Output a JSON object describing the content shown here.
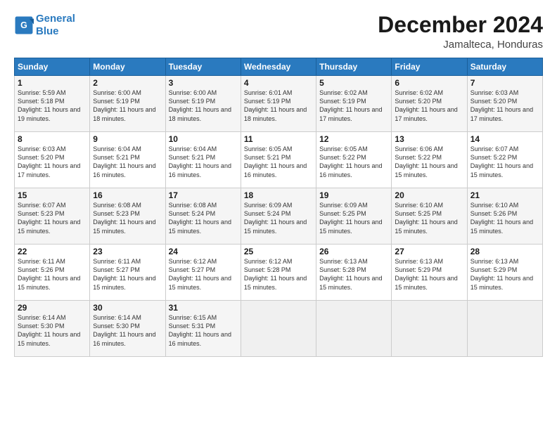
{
  "logo": {
    "line1": "General",
    "line2": "Blue"
  },
  "title": "December 2024",
  "subtitle": "Jamalteca, Honduras",
  "days_of_week": [
    "Sunday",
    "Monday",
    "Tuesday",
    "Wednesday",
    "Thursday",
    "Friday",
    "Saturday"
  ],
  "weeks": [
    [
      {
        "day": "1",
        "sunrise": "5:59 AM",
        "sunset": "5:18 PM",
        "daylight": "11 hours and 19 minutes."
      },
      {
        "day": "2",
        "sunrise": "6:00 AM",
        "sunset": "5:19 PM",
        "daylight": "11 hours and 18 minutes."
      },
      {
        "day": "3",
        "sunrise": "6:00 AM",
        "sunset": "5:19 PM",
        "daylight": "11 hours and 18 minutes."
      },
      {
        "day": "4",
        "sunrise": "6:01 AM",
        "sunset": "5:19 PM",
        "daylight": "11 hours and 18 minutes."
      },
      {
        "day": "5",
        "sunrise": "6:02 AM",
        "sunset": "5:19 PM",
        "daylight": "11 hours and 17 minutes."
      },
      {
        "day": "6",
        "sunrise": "6:02 AM",
        "sunset": "5:20 PM",
        "daylight": "11 hours and 17 minutes."
      },
      {
        "day": "7",
        "sunrise": "6:03 AM",
        "sunset": "5:20 PM",
        "daylight": "11 hours and 17 minutes."
      }
    ],
    [
      {
        "day": "8",
        "sunrise": "6:03 AM",
        "sunset": "5:20 PM",
        "daylight": "11 hours and 17 minutes."
      },
      {
        "day": "9",
        "sunrise": "6:04 AM",
        "sunset": "5:21 PM",
        "daylight": "11 hours and 16 minutes."
      },
      {
        "day": "10",
        "sunrise": "6:04 AM",
        "sunset": "5:21 PM",
        "daylight": "11 hours and 16 minutes."
      },
      {
        "day": "11",
        "sunrise": "6:05 AM",
        "sunset": "5:21 PM",
        "daylight": "11 hours and 16 minutes."
      },
      {
        "day": "12",
        "sunrise": "6:05 AM",
        "sunset": "5:22 PM",
        "daylight": "11 hours and 16 minutes."
      },
      {
        "day": "13",
        "sunrise": "6:06 AM",
        "sunset": "5:22 PM",
        "daylight": "11 hours and 15 minutes."
      },
      {
        "day": "14",
        "sunrise": "6:07 AM",
        "sunset": "5:22 PM",
        "daylight": "11 hours and 15 minutes."
      }
    ],
    [
      {
        "day": "15",
        "sunrise": "6:07 AM",
        "sunset": "5:23 PM",
        "daylight": "11 hours and 15 minutes."
      },
      {
        "day": "16",
        "sunrise": "6:08 AM",
        "sunset": "5:23 PM",
        "daylight": "11 hours and 15 minutes."
      },
      {
        "day": "17",
        "sunrise": "6:08 AM",
        "sunset": "5:24 PM",
        "daylight": "11 hours and 15 minutes."
      },
      {
        "day": "18",
        "sunrise": "6:09 AM",
        "sunset": "5:24 PM",
        "daylight": "11 hours and 15 minutes."
      },
      {
        "day": "19",
        "sunrise": "6:09 AM",
        "sunset": "5:25 PM",
        "daylight": "11 hours and 15 minutes."
      },
      {
        "day": "20",
        "sunrise": "6:10 AM",
        "sunset": "5:25 PM",
        "daylight": "11 hours and 15 minutes."
      },
      {
        "day": "21",
        "sunrise": "6:10 AM",
        "sunset": "5:26 PM",
        "daylight": "11 hours and 15 minutes."
      }
    ],
    [
      {
        "day": "22",
        "sunrise": "6:11 AM",
        "sunset": "5:26 PM",
        "daylight": "11 hours and 15 minutes."
      },
      {
        "day": "23",
        "sunrise": "6:11 AM",
        "sunset": "5:27 PM",
        "daylight": "11 hours and 15 minutes."
      },
      {
        "day": "24",
        "sunrise": "6:12 AM",
        "sunset": "5:27 PM",
        "daylight": "11 hours and 15 minutes."
      },
      {
        "day": "25",
        "sunrise": "6:12 AM",
        "sunset": "5:28 PM",
        "daylight": "11 hours and 15 minutes."
      },
      {
        "day": "26",
        "sunrise": "6:13 AM",
        "sunset": "5:28 PM",
        "daylight": "11 hours and 15 minutes."
      },
      {
        "day": "27",
        "sunrise": "6:13 AM",
        "sunset": "5:29 PM",
        "daylight": "11 hours and 15 minutes."
      },
      {
        "day": "28",
        "sunrise": "6:13 AM",
        "sunset": "5:29 PM",
        "daylight": "11 hours and 15 minutes."
      }
    ],
    [
      {
        "day": "29",
        "sunrise": "6:14 AM",
        "sunset": "5:30 PM",
        "daylight": "11 hours and 15 minutes."
      },
      {
        "day": "30",
        "sunrise": "6:14 AM",
        "sunset": "5:30 PM",
        "daylight": "11 hours and 16 minutes."
      },
      {
        "day": "31",
        "sunrise": "6:15 AM",
        "sunset": "5:31 PM",
        "daylight": "11 hours and 16 minutes."
      },
      null,
      null,
      null,
      null
    ]
  ],
  "labels": {
    "sunrise": "Sunrise:",
    "sunset": "Sunset:",
    "daylight": "Daylight:"
  }
}
